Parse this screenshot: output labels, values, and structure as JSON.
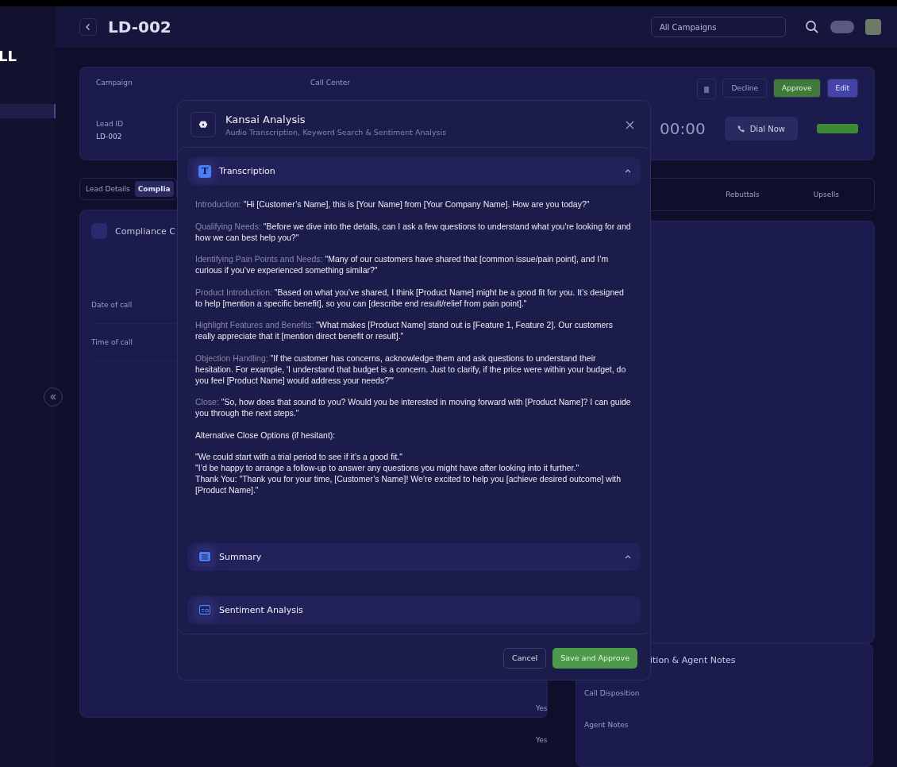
{
  "sidebar": {
    "logo": "LL"
  },
  "header": {
    "title": "LD-002",
    "campaign_select": "All Campaigns"
  },
  "lead_card": {
    "fields": [
      {
        "label": "Campaign"
      },
      {
        "label": "Call Center"
      },
      {
        "label": "Lead ID",
        "value": "LD-002"
      }
    ],
    "actions": [
      "Decline",
      "Approve",
      "Edit"
    ],
    "timer": "00:00",
    "dial_button": "Dial Now"
  },
  "left_panel": {
    "tabs": [
      {
        "label": "Lead Details",
        "selected": false
      },
      {
        "label": "Complia",
        "selected": true
      }
    ],
    "card_title": "Compliance C",
    "rows": [
      "Date of call",
      "Time of call"
    ],
    "answers": [
      "Yes",
      "Yes"
    ]
  },
  "right_panel": {
    "tabs": [
      {
        "label": "Rebuttals",
        "selected": false
      },
      {
        "label": "Upsells",
        "selected": false
      }
    ],
    "notes_title": "ition & Agent Notes",
    "fields": [
      "Call Disposition",
      "Agent Notes"
    ]
  },
  "modal": {
    "title": "Kansai Analysis",
    "subtitle": "Audio Transcription, Keyword Search & Sentiment Analysis",
    "sections": [
      {
        "title": "Transcription",
        "kind": "text",
        "icon_text": "T",
        "expanded": true,
        "paragraphs": [
          {
            "kind": "labeled",
            "label": "Introduction:",
            "text": "\"Hi [Customer’s Name], this is [Your Name] from [Your Company Name]. How are you today?\""
          },
          {
            "kind": "labeled",
            "label": "Qualifying Needs:",
            "text": "\"Before we dive into the details, can I ask a few questions to understand what you're looking for and how we can best help you?\""
          },
          {
            "kind": "labeled",
            "label": "Identifying Pain Points and Needs:",
            "text": "\"Many of our customers have shared that [common issue/pain point], and I’m curious if you’ve experienced something similar?\""
          },
          {
            "kind": "labeled",
            "label": "Product Introduction:",
            "text": "\"Based on what you’ve shared, I think [Product Name] might be a good fit for you. It’s designed to help [mention a specific benefit], so you can [describe end result/relief from pain point].\""
          },
          {
            "kind": "labeled",
            "label": "Highlight Features and Benefits:",
            "text": "\"What makes [Product Name] stand out is [Feature 1, Feature 2]. Our customers really appreciate that it [mention direct benefit or result].\""
          },
          {
            "kind": "labeled",
            "label": "Objection Handling:",
            "text": "\"If the customer has concerns, acknowledge them and ask questions to understand their hesitation. For example, 'I understand that budget is a concern. Just to clarify, if the price were within your budget, do you feel [Product Name] would address your needs?'\""
          },
          {
            "kind": "labeled",
            "label": "Close:",
            "text": "\"So, how does that sound to you? Would you be interested in moving forward with [Product Name]? I can guide you through the next steps.\""
          },
          {
            "kind": "plain",
            "text": "Alternative Close Options (if hesitant):"
          },
          {
            "kind": "lines",
            "lines": [
              "\"We could start with a trial period to see if it’s a good fit.\"",
              "\"I’d be happy to arrange a follow-up to answer any questions you might have after looking into it further.\"",
              "Thank You: \"Thank you for your time, [Customer’s Name]! We’re excited to help you [achieve desired outcome] with [Product Name].\""
            ]
          }
        ]
      },
      {
        "title": "Summary",
        "kind": "list",
        "expanded": true
      },
      {
        "title": "Sentiment Analysis",
        "kind": "chart",
        "expanded": false
      }
    ],
    "buttons": [
      {
        "label": "Cancel",
        "kind": "secondary"
      },
      {
        "label": "Save and Approve",
        "kind": "primary"
      }
    ]
  }
}
